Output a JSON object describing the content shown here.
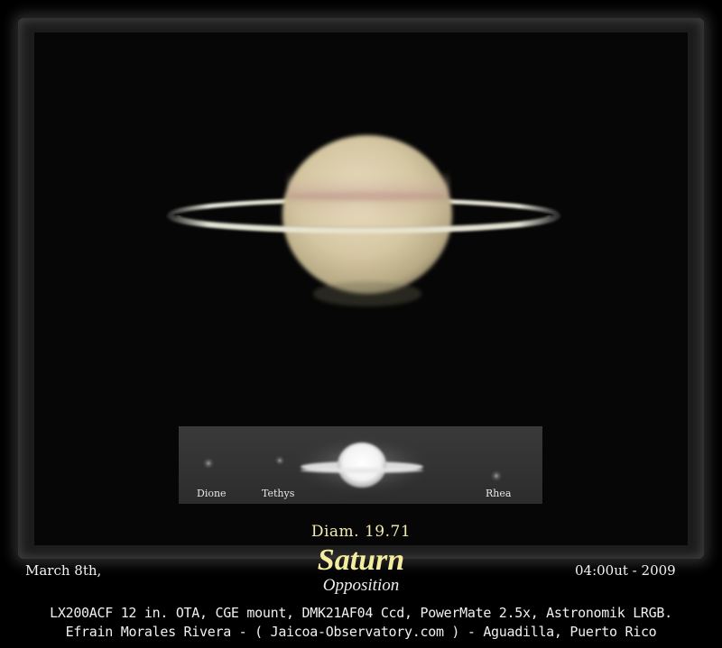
{
  "inset": {
    "moons": [
      {
        "name": "Dione"
      },
      {
        "name": "Tethys"
      },
      {
        "name": "Rhea"
      }
    ]
  },
  "caption": {
    "diameter": "Diam. 19.71",
    "date": "March 8th,",
    "time": "04:00ut - 2009",
    "title": "Saturn",
    "subtitle": "Opposition",
    "equipment": "LX200ACF 12 in. OTA, CGE mount, DMK21AF04 Ccd, PowerMate 2.5x, Astronomik LRGB.",
    "credit": "Efrain Morales Rivera - ( Jaicoa-Observatory.com ) - Aguadilla, Puerto Rico"
  },
  "colors": {
    "title": "#f4ec9e",
    "background": "#000000"
  }
}
